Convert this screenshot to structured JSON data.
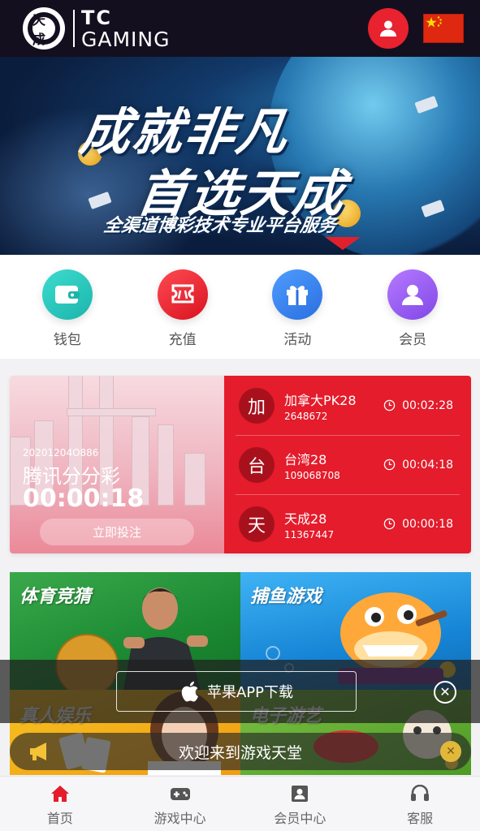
{
  "header": {
    "logo_mark": "天成",
    "logo_line1": "TC",
    "logo_line2": "GAMING"
  },
  "banner": {
    "headline_1": "成就非凡",
    "headline_2": "首选天成",
    "tagline": "全渠道博彩技术专业平台服务"
  },
  "quick_menu": [
    {
      "label": "钱包",
      "icon": "wallet-icon",
      "color": "#2ccbc0"
    },
    {
      "label": "充值",
      "icon": "recharge-icon",
      "color": "#ef2b36"
    },
    {
      "label": "活动",
      "icon": "gift-icon",
      "color": "#3a86f0"
    },
    {
      "label": "会员",
      "icon": "member-icon",
      "color": "#9b5cf0"
    }
  ],
  "lottery": {
    "featured": {
      "issue": "20201204O886",
      "name": "腾讯分分彩",
      "countdown": "00:00:18",
      "bet_button": "立即投注"
    },
    "list": [
      {
        "badge": "加",
        "name": "加拿大PK28",
        "code": "2648672",
        "time": "00:02:28"
      },
      {
        "badge": "台",
        "name": "台湾28",
        "code": "109068708",
        "time": "00:04:18"
      },
      {
        "badge": "天",
        "name": "天成28",
        "code": "11367447",
        "time": "00:00:18"
      }
    ]
  },
  "games": {
    "sports": "体育竞猜",
    "fishing": "捕鱼游戏",
    "live": "真人娱乐",
    "slots": "电子游艺"
  },
  "app_download": {
    "label": "苹果APP下载",
    "close_icon": "close-icon"
  },
  "marquee": {
    "text": "欢迎来到游戏天堂"
  },
  "bottom_nav": [
    {
      "label": "首页",
      "icon": "home-icon",
      "active": true
    },
    {
      "label": "游戏中心",
      "icon": "gamepad-icon",
      "active": false
    },
    {
      "label": "会员中心",
      "icon": "member-card-icon",
      "active": false
    },
    {
      "label": "客服",
      "icon": "headset-icon",
      "active": false
    }
  ],
  "colors": {
    "header_bg": "#140f1f",
    "accent_red": "#e41c2b",
    "nav_active": "#e41c2b"
  }
}
